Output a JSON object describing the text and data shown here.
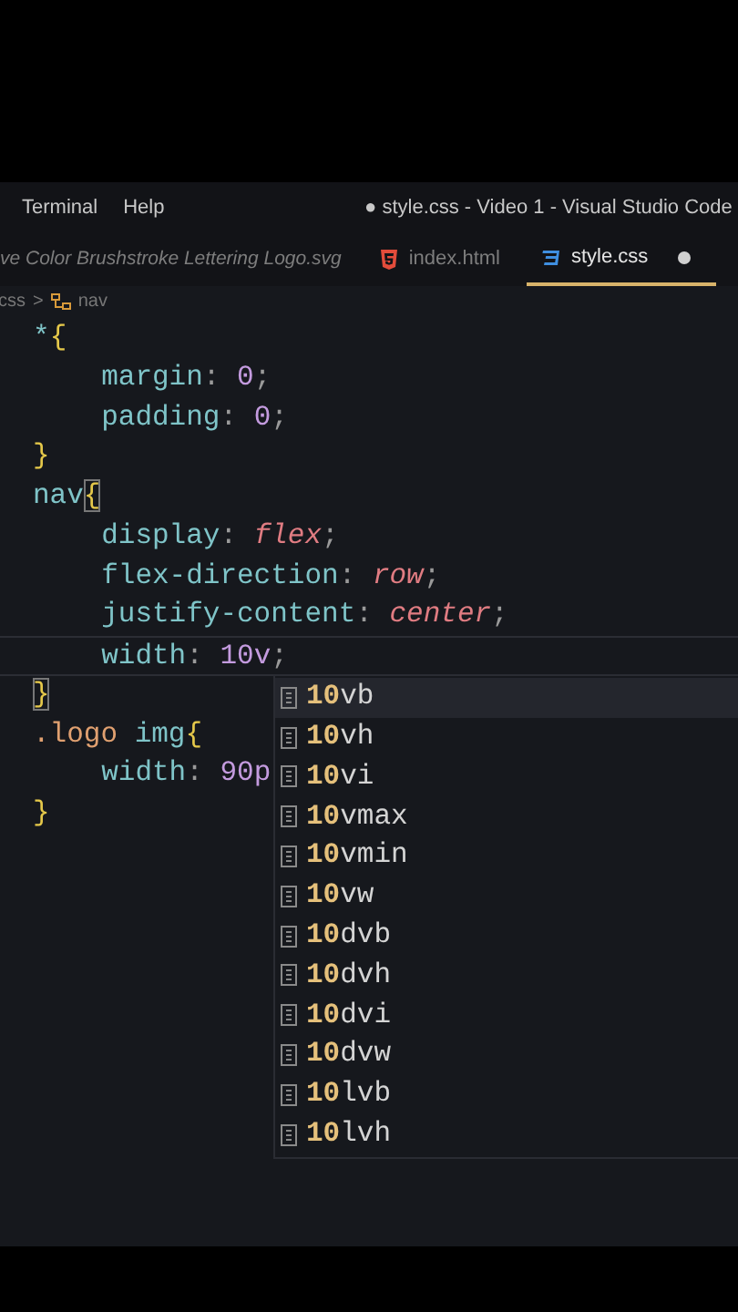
{
  "menu": [
    "Terminal",
    "Help"
  ],
  "window": {
    "title": "● style.css - Video 1 - Visual Studio Code"
  },
  "tabs": [
    {
      "label": "ve Color Brushstroke Lettering Logo.svg",
      "kind": "svg",
      "preview": true,
      "selected": false,
      "modified": false
    },
    {
      "label": "index.html",
      "kind": "html",
      "preview": false,
      "selected": false,
      "modified": false
    },
    {
      "label": "style.css",
      "kind": "css",
      "preview": false,
      "selected": true,
      "modified": true
    }
  ],
  "breadcrumb": {
    "file": "css",
    "separator": ">",
    "symbol": "nav"
  },
  "code": [
    {
      "tokens": [
        {
          "text": "*",
          "kind": "selector"
        },
        {
          "text": "{",
          "kind": "brace",
          "matched": false
        }
      ],
      "current": false,
      "children": [
        {
          "tokens": [
            {
              "text": "margin",
              "kind": "property"
            },
            {
              "text": ": ",
              "kind": "punct"
            },
            {
              "text": "0",
              "kind": "number"
            },
            {
              "text": ";",
              "kind": "punct"
            }
          ],
          "current": false
        },
        {
          "tokens": [
            {
              "text": "padding",
              "kind": "property"
            },
            {
              "text": ": ",
              "kind": "punct"
            },
            {
              "text": "0",
              "kind": "number"
            },
            {
              "text": ";",
              "kind": "punct"
            }
          ],
          "current": false
        }
      ]
    },
    {
      "tokens": [
        {
          "text": "}",
          "kind": "brace",
          "matched": false
        }
      ],
      "current": false
    },
    {
      "tokens": [
        {
          "text": "nav",
          "kind": "selector"
        },
        {
          "text": "{",
          "kind": "brace",
          "matched": true
        }
      ],
      "current": false,
      "children": [
        {
          "tokens": [
            {
              "text": "display",
              "kind": "property"
            },
            {
              "text": ": ",
              "kind": "punct"
            },
            {
              "text": "flex",
              "kind": "keyword"
            },
            {
              "text": ";",
              "kind": "punct"
            }
          ],
          "current": false
        },
        {
          "tokens": [
            {
              "text": "flex-direction",
              "kind": "property"
            },
            {
              "text": ": ",
              "kind": "punct"
            },
            {
              "text": "row",
              "kind": "keyword"
            },
            {
              "text": ";",
              "kind": "punct"
            }
          ],
          "current": false
        },
        {
          "tokens": [
            {
              "text": "justify-content",
              "kind": "property"
            },
            {
              "text": ": ",
              "kind": "punct"
            },
            {
              "text": "center",
              "kind": "keyword"
            },
            {
              "text": ";",
              "kind": "punct"
            }
          ],
          "current": false
        },
        {
          "tokens": [
            {
              "text": "width",
              "kind": "property"
            },
            {
              "text": ": ",
              "kind": "punct"
            },
            {
              "text": "10v",
              "kind": "number"
            },
            {
              "text": ";",
              "kind": "punct"
            }
          ],
          "current": true
        }
      ]
    },
    {
      "tokens": [
        {
          "text": "}",
          "kind": "brace",
          "matched": true
        }
      ],
      "current": false
    },
    {
      "tokens": [
        {
          "text": ".logo",
          "kind": "class"
        },
        {
          "text": " img",
          "kind": "selector"
        },
        {
          "text": "{",
          "kind": "brace",
          "matched": false
        }
      ],
      "current": false,
      "children": [
        {
          "tokens": [
            {
              "text": "width",
              "kind": "property"
            },
            {
              "text": ": ",
              "kind": "punct"
            },
            {
              "text": "90p",
              "kind": "number"
            }
          ],
          "current": false
        }
      ]
    },
    {
      "tokens": [
        {
          "text": "}",
          "kind": "brace",
          "matched": false
        }
      ],
      "current": false
    }
  ],
  "suggestions": [
    {
      "label": "**10**vb",
      "selected": true
    },
    {
      "label": "**10**vh",
      "selected": false
    },
    {
      "label": "**10**vi",
      "selected": false
    },
    {
      "label": "**10**vmax",
      "selected": false
    },
    {
      "label": "**10**vmin",
      "selected": false
    },
    {
      "label": "**10**vw",
      "selected": false
    },
    {
      "label": "**10**dvb",
      "selected": false
    },
    {
      "label": "**10**dvh",
      "selected": false
    },
    {
      "label": "**10**dvi",
      "selected": false
    },
    {
      "label": "**10**dvw",
      "selected": false
    },
    {
      "label": "**10**lvb",
      "selected": false
    },
    {
      "label": "**10**lvh",
      "selected": false
    }
  ]
}
